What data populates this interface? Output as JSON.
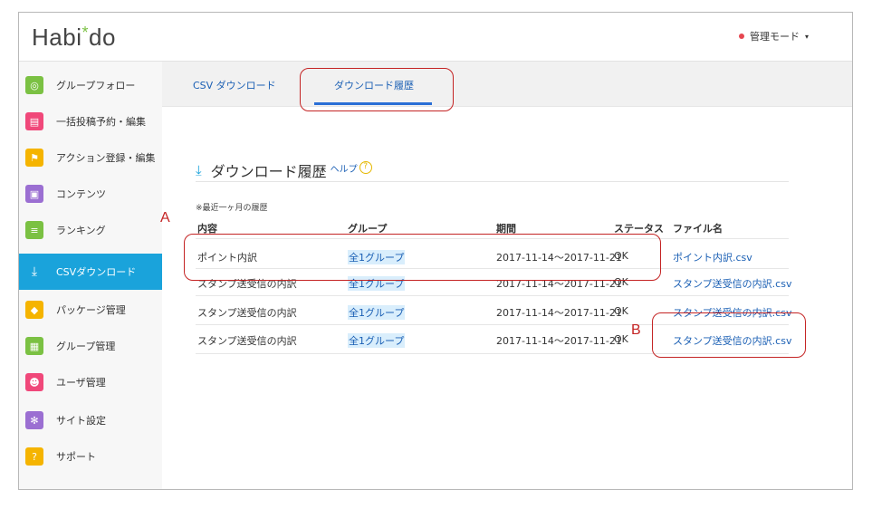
{
  "app": {
    "logo_text": "Habi",
    "logo_star": "*",
    "logo_suffix": "do",
    "admin_label": "管理モード",
    "admin_caret": "▾"
  },
  "sidebar": {
    "items": [
      {
        "label": "グループフォロー",
        "icon": "follow-icon",
        "color": "#7bc143",
        "glyph": "◎"
      },
      {
        "label": "一括投稿予約・編集",
        "icon": "post-icon",
        "color": "#f0487a",
        "glyph": "▤"
      },
      {
        "label": "アクション登録・編集",
        "icon": "flag-icon",
        "color": "#f5b400",
        "glyph": "⚑"
      },
      {
        "label": "コンテンツ",
        "icon": "contents-icon",
        "color": "#9b6fd2",
        "glyph": "▣"
      },
      {
        "label": "ランキング",
        "icon": "ranking-icon",
        "color": "#7bc143",
        "glyph": "≡"
      },
      {
        "label": "CSVダウンロード",
        "icon": "download-icon",
        "color": "#1aa3db",
        "glyph": "⤓"
      },
      {
        "label": "パッケージ管理",
        "icon": "package-icon",
        "color": "#f5b400",
        "glyph": "◆"
      },
      {
        "label": "グループ管理",
        "icon": "group-icon",
        "color": "#7bc143",
        "glyph": "▦"
      },
      {
        "label": "ユーザ管理",
        "icon": "user-icon",
        "color": "#f0487a",
        "glyph": "☻"
      },
      {
        "label": "サイト設定",
        "icon": "settings-icon",
        "color": "#9b6fd2",
        "glyph": "✻"
      },
      {
        "label": "サポート",
        "icon": "support-icon",
        "color": "#f5b400",
        "glyph": "?"
      }
    ],
    "active_index": 5
  },
  "tabs": [
    {
      "label": "CSV ダウンロード"
    },
    {
      "label": "ダウンロード履歴"
    }
  ],
  "section": {
    "title": "ダウンロード履歴",
    "help_label": "ヘルプ",
    "help_icon": "?",
    "download_icon": "⤓"
  },
  "note": "※最近一ヶ月の履歴",
  "table": {
    "headers": [
      "内容",
      "グループ",
      "期間",
      "ステータス",
      "ファイル名"
    ],
    "rows": [
      {
        "content": "ポイント内訳",
        "group": "全1グループ",
        "period": "2017-11-14〜2017-11-21",
        "status": "OK",
        "file": "ポイント内訳.csv"
      },
      {
        "content": "スタンプ送受信の内訳",
        "group": "全1グループ",
        "period": "2017-11-14〜2017-11-21",
        "status": "OK",
        "file": "スタンプ送受信の内訳.csv"
      },
      {
        "content": "スタンプ送受信の内訳",
        "group": "全1グループ",
        "period": "2017-11-14〜2017-11-21",
        "status": "OK",
        "file": "スタンプ送受信の内訳.csv"
      },
      {
        "content": "スタンプ送受信の内訳",
        "group": "全1グループ",
        "period": "2017-11-14〜2017-11-21",
        "status": "OK",
        "file": "スタンプ送受信の内訳.csv"
      }
    ]
  },
  "annotations": {
    "a_label": "A",
    "b_label": "B",
    "color": "#c42424"
  }
}
